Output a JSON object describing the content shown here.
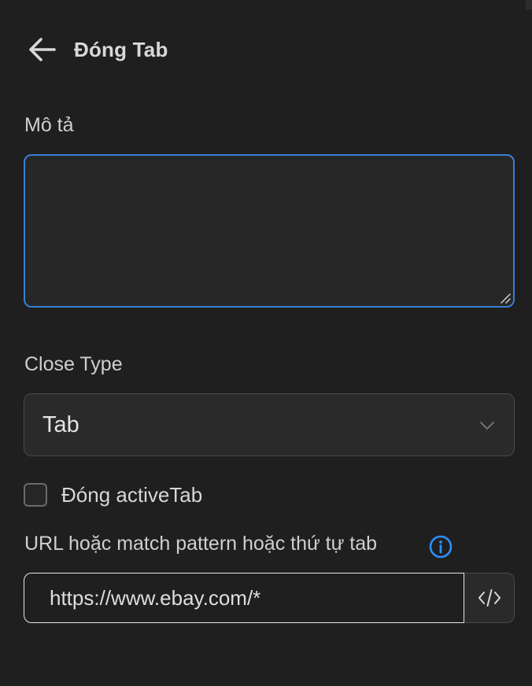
{
  "colors": {
    "background": "#1f1f1f",
    "accent": "#3a7fd5",
    "info": "#2e8fff"
  },
  "header": {
    "back_icon": "arrow-left-icon",
    "title": "Đóng Tab"
  },
  "description": {
    "label": "Mô tả",
    "value": ""
  },
  "close_type": {
    "label": "Close Type",
    "selected": "Tab",
    "icon": "chevron-down-icon"
  },
  "active_tab": {
    "label": "Đóng activeTab",
    "checked": false
  },
  "url": {
    "label": "URL hoặc match pattern hoặc thứ tự tab",
    "info_icon": "info-icon",
    "value": "https://www.ebay.com/*",
    "code_icon": "code-icon"
  }
}
